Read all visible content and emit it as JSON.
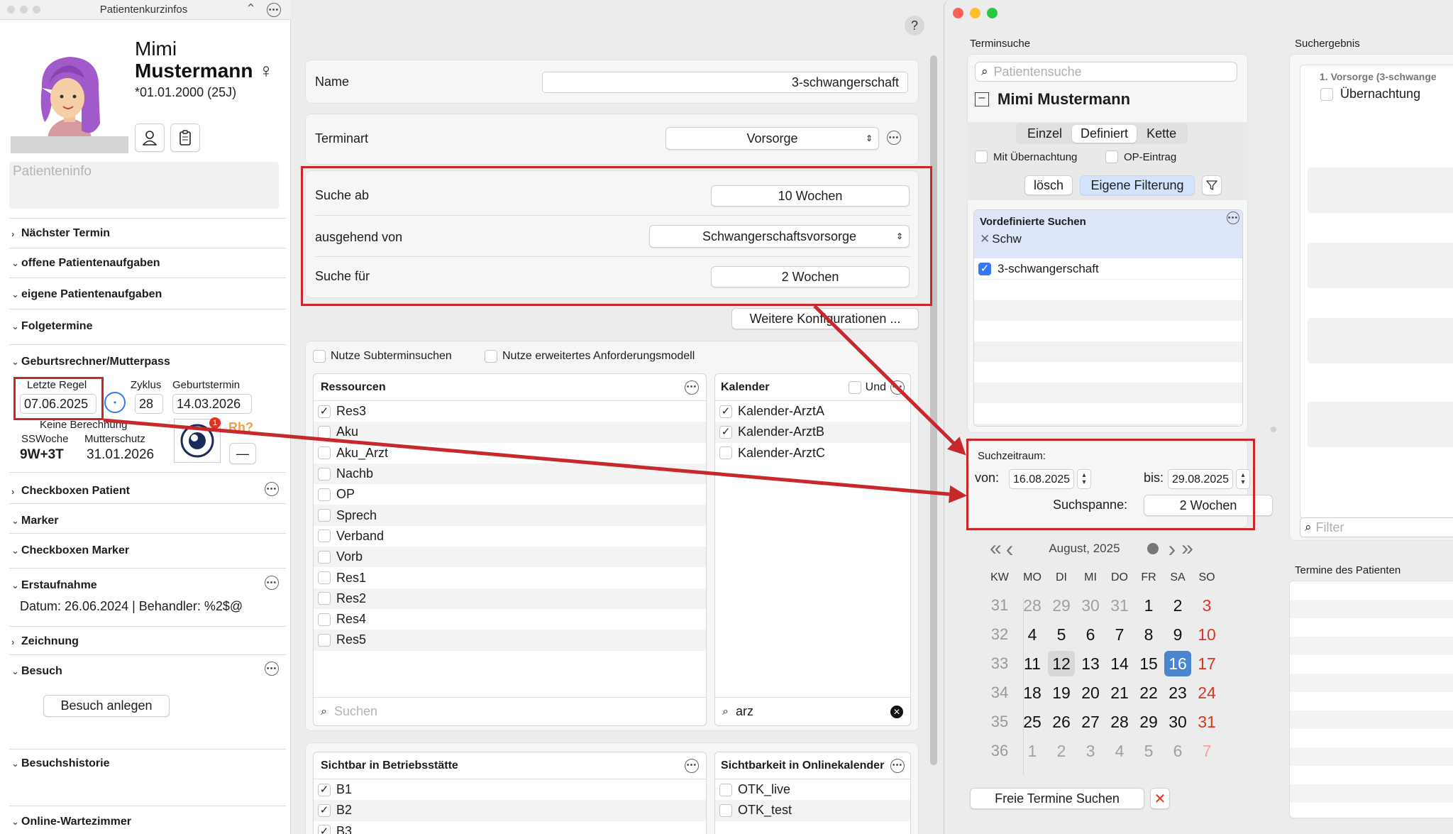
{
  "left": {
    "title": "Patientenkurzinfos",
    "first_name": "Mimi",
    "last_name": "Mustermann",
    "gender_symbol": "♀",
    "birth": "*01.01.2000 (25J)",
    "info_placeholder": "Patienteninfo",
    "sections": [
      {
        "label": "Nächster Termin",
        "open": false
      },
      {
        "label": "offene Patientenaufgaben",
        "open": true
      },
      {
        "label": "eigene Patientenaufgaben",
        "open": true
      },
      {
        "label": "Folgetermine",
        "open": true
      },
      {
        "label": "Geburtsrechner/Mutterpass",
        "open": true
      },
      {
        "label": "Checkboxen Patient",
        "open": false
      },
      {
        "label": "Marker",
        "open": true
      },
      {
        "label": "Checkboxen Marker",
        "open": true
      },
      {
        "label": "Erstaufnahme",
        "open": true
      },
      {
        "label": "Zeichnung",
        "open": false
      },
      {
        "label": "Besuch",
        "open": true
      },
      {
        "label": "Besuchshistorie",
        "open": true
      },
      {
        "label": "Online-Wartezimmer",
        "open": true
      }
    ],
    "pregnancy": {
      "lmp_label": "Letzte Regel",
      "lmp": "07.06.2025",
      "cycle_label": "Zyklus",
      "cycle": "28",
      "due_label": "Geburtstermin",
      "due": "14.03.2026",
      "no_calc": "Keine Berechnung",
      "ssw_label": "SSWoche",
      "ssw": "9W+3T",
      "ms_label": "Mutterschutz",
      "ms": "31.01.2026",
      "rh": "Rh?",
      "badge": "1"
    },
    "erstaufnahme_text": "Datum: 26.06.2024 | Behandler: %2$@",
    "besuch_button": "Besuch anlegen"
  },
  "middle": {
    "help": "?",
    "name_label": "Name",
    "name_value": "3-schwangerschaft",
    "terminart_label": "Terminart",
    "terminart_value": "Vorsorge",
    "suche_ab_label": "Suche ab",
    "suche_ab_value": "10 Wochen",
    "ausgehend_label": "ausgehend von",
    "ausgehend_value": "Schwangerschaftsvorsorge",
    "suche_fuer_label": "Suche für",
    "suche_fuer_value": "2 Wochen",
    "weitere_button": "Weitere Konfigurationen ...",
    "subtermin": "Nutze Subterminsuchen",
    "anforderung": "Nutze erweitertes Anforderungsmodell",
    "ressourcen_header": "Ressourcen",
    "ressourcen": [
      {
        "label": "Res3",
        "checked": true
      },
      {
        "label": "Aku",
        "checked": false
      },
      {
        "label": "Aku_Arzt",
        "checked": false
      },
      {
        "label": "Nachb",
        "checked": false
      },
      {
        "label": "OP",
        "checked": false
      },
      {
        "label": "Sprech",
        "checked": false
      },
      {
        "label": "Verband",
        "checked": false
      },
      {
        "label": "Vorb",
        "checked": false
      },
      {
        "label": "Res1",
        "checked": false
      },
      {
        "label": "Res2",
        "checked": false
      },
      {
        "label": "Res4",
        "checked": false
      },
      {
        "label": "Res5",
        "checked": false
      }
    ],
    "ressourcen_search": "Suchen",
    "kalender_header": "Kalender",
    "kalender_und": "Und",
    "kalender": [
      {
        "label": "Kalender-ArztA",
        "checked": true
      },
      {
        "label": "Kalender-ArztB",
        "checked": true
      },
      {
        "label": "Kalender-ArztC",
        "checked": false
      }
    ],
    "kalender_search": "arz",
    "betrieb_header": "Sichtbar in Betriebsstätte",
    "betrieb": [
      {
        "label": "B1",
        "checked": true
      },
      {
        "label": "B2",
        "checked": true
      },
      {
        "label": "B3",
        "checked": true
      }
    ],
    "online_header": "Sichtbarkeit in Onlinekalender",
    "online": [
      {
        "label": "OTK_live",
        "checked": false
      },
      {
        "label": "OTK_test",
        "checked": false
      }
    ]
  },
  "right": {
    "terminsuche_label": "Terminsuche",
    "search_placeholder": "Patientensuche",
    "patient_name": "Mimi Mustermann",
    "segments": [
      "Einzel",
      "Definiert",
      "Kette"
    ],
    "uebernachtung": "Mit Übernachtung",
    "op_eintrag": "OP-Eintrag",
    "losch": "lösch",
    "eigene": "Eigene Filterung",
    "vordef_header": "Vordefinierte Suchen",
    "vordef_filter": "Schw",
    "vordef_item": "3-schwangerschaft",
    "suchzeitraum": "Suchzeitraum:",
    "von_label": "von:",
    "von": "16.08.2025",
    "bis_label": "bis:",
    "bis": "29.08.2025",
    "spanne_label": "Suchspanne:",
    "spanne": "2 Wochen",
    "month": "August, 2025",
    "weekdays": [
      "KW",
      "MO",
      "DI",
      "MI",
      "DO",
      "FR",
      "SA",
      "SO"
    ],
    "weeks": [
      {
        "kw": "31",
        "days": [
          "28",
          "29",
          "30",
          "31",
          "1",
          "2",
          "3"
        ]
      },
      {
        "kw": "32",
        "days": [
          "4",
          "5",
          "6",
          "7",
          "8",
          "9",
          "10"
        ]
      },
      {
        "kw": "33",
        "days": [
          "11",
          "12",
          "13",
          "14",
          "15",
          "16",
          "17"
        ]
      },
      {
        "kw": "34",
        "days": [
          "18",
          "19",
          "20",
          "21",
          "22",
          "23",
          "24"
        ]
      },
      {
        "kw": "35",
        "days": [
          "25",
          "26",
          "27",
          "28",
          "29",
          "30",
          "31"
        ]
      },
      {
        "kw": "36",
        "days": [
          "1",
          "2",
          "3",
          "4",
          "5",
          "6",
          "7"
        ]
      }
    ],
    "free_button": "Freie Termine Suchen",
    "suchergebnis_label": "Suchergebnis",
    "result_group": "1. Vorsorge (3-schwange",
    "result_item": "Übernachtung",
    "filter_placeholder": "Filter",
    "termine_label": "Termine des Patienten"
  },
  "colors": {
    "annotation": "#c6282c",
    "accent": "#3478f6",
    "sunday": "#e0321f"
  }
}
